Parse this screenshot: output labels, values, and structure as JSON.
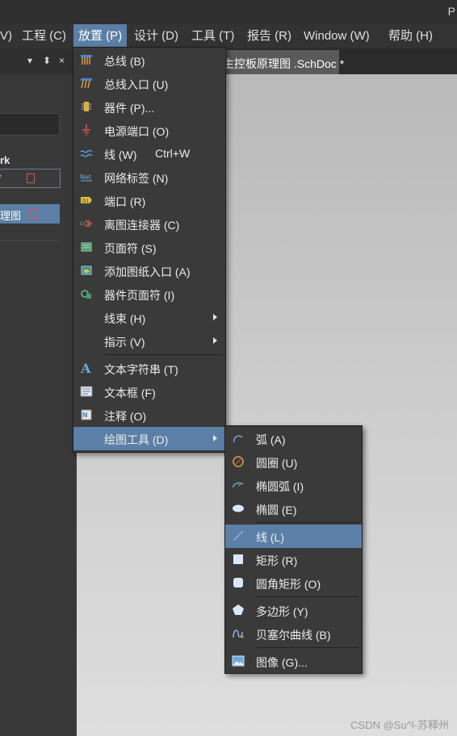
{
  "titlebar": {
    "app_letter": "P"
  },
  "menubar": {
    "items": [
      {
        "label": "V)"
      },
      {
        "label": "工程 (C)"
      },
      {
        "label": "放置 (P)"
      },
      {
        "label": "设计 (D)"
      },
      {
        "label": "工具 (T)"
      },
      {
        "label": "报告 (R)"
      },
      {
        "label": "Window (W)"
      },
      {
        "label": "帮助 (H)"
      }
    ]
  },
  "left_panel": {
    "header_icons": [
      "▾",
      "⬍",
      "×"
    ],
    "section_label": "rk",
    "file1": "*",
    "file2": "理图"
  },
  "document_tab": {
    "title": "主控板原理图 .SchDoc *"
  },
  "place_menu": {
    "items": [
      {
        "label": "总线 (B)",
        "icon": "bus-icon",
        "shortcut": ""
      },
      {
        "label": "总线入口 (U)",
        "icon": "bus-entry-icon",
        "shortcut": ""
      },
      {
        "label": "器件 (P)...",
        "icon": "part-icon",
        "shortcut": ""
      },
      {
        "label": "电源端口 (O)",
        "icon": "power-port-icon",
        "shortcut": ""
      },
      {
        "label": "线 (W)",
        "icon": "wire-icon",
        "shortcut": "Ctrl+W"
      },
      {
        "label": "网络标签 (N)",
        "icon": "net-label-icon",
        "shortcut": ""
      },
      {
        "label": "端口 (R)",
        "icon": "port-icon",
        "shortcut": ""
      },
      {
        "label": "离图连接器 (C)",
        "icon": "off-sheet-connector-icon",
        "shortcut": ""
      },
      {
        "label": "页面符 (S)",
        "icon": "sheet-symbol-icon",
        "shortcut": ""
      },
      {
        "label": "添加图纸入口 (A)",
        "icon": "sheet-entry-icon",
        "shortcut": ""
      },
      {
        "label": "器件页面符 (I)",
        "icon": "device-sheet-symbol-icon",
        "shortcut": ""
      },
      {
        "label": "线束 (H)",
        "icon": "",
        "shortcut": "",
        "submenu": true
      },
      {
        "label": "指示 (V)",
        "icon": "",
        "shortcut": "",
        "submenu": true
      },
      {
        "label": "文本字符串 (T)",
        "icon": "text-string-icon",
        "shortcut": ""
      },
      {
        "label": "文本框 (F)",
        "icon": "text-frame-icon",
        "shortcut": ""
      },
      {
        "label": "注释 (O)",
        "icon": "note-icon",
        "shortcut": ""
      },
      {
        "label": "绘图工具 (D)",
        "icon": "",
        "shortcut": "",
        "submenu": true,
        "highlighted": true
      }
    ]
  },
  "drawing_tools_menu": {
    "items": [
      {
        "label": "弧 (A)",
        "icon": "arc-icon"
      },
      {
        "label": "圆圈 (U)",
        "icon": "circle-icon"
      },
      {
        "label": "椭圆弧 (I)",
        "icon": "elliptical-arc-icon"
      },
      {
        "label": "椭圆 (E)",
        "icon": "ellipse-icon"
      },
      {
        "label": "线 (L)",
        "icon": "line-icon",
        "highlighted": true
      },
      {
        "label": "矩形 (R)",
        "icon": "rectangle-icon"
      },
      {
        "label": "圆角矩形 (O)",
        "icon": "round-rectangle-icon"
      },
      {
        "label": "多边形 (Y)",
        "icon": "polygon-icon"
      },
      {
        "label": "贝塞尔曲线 (B)",
        "icon": "bezier-icon"
      },
      {
        "label": "图像 (G)...",
        "icon": "image-icon"
      }
    ]
  },
  "watermark": "CSDN @Su^l-苏释州",
  "colors": {
    "highlight": "#5b7fa6",
    "menu_bg": "#3a3a3a",
    "menubar_bg": "#333333",
    "canvas": "#cdcdcd"
  }
}
